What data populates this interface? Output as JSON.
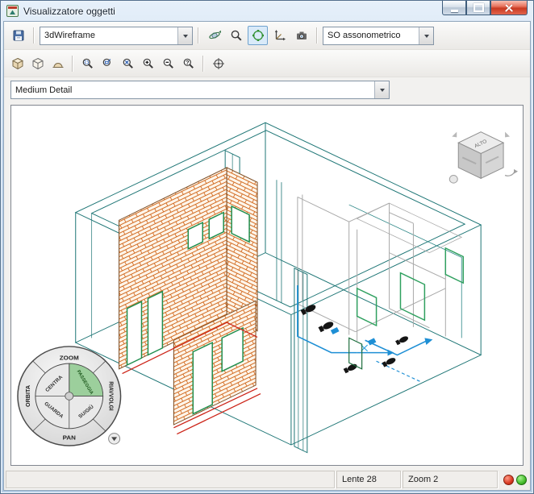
{
  "window": {
    "title": "Visualizzatore oggetti",
    "controls": [
      "minimize",
      "maximize",
      "close"
    ]
  },
  "toolbar_top": {
    "save_icon": "save-icon",
    "visual_style": {
      "value": "3dWireframe"
    },
    "buttons": [
      "orbit",
      "zoom",
      "constrained-orbit",
      "ucs-axes",
      "camera"
    ],
    "active_button": "constrained-orbit",
    "view_preset": {
      "value": "SO assonometrico"
    }
  },
  "toolbar_view": {
    "buttons": [
      "view-parallel",
      "view-perspective",
      "view-dome",
      "zoom-window",
      "zoom-dynamic",
      "zoom-extents",
      "zoom-in",
      "zoom-out",
      "zoom-help",
      "center-view"
    ]
  },
  "detail_combo": {
    "value": "Medium Detail"
  },
  "glyphs": {
    "question": "?"
  },
  "viewcube": {
    "top_label": "ALTO"
  },
  "wheel": {
    "zoom": "ZOOM",
    "riavvolgi": "RIAVVOLGI",
    "pan": "PAN",
    "orbita": "ORBITA",
    "centra": "CENTRA",
    "passeggia": "PASSEGGIA",
    "guarda": "GUARDA",
    "su_giu": "SU/GIÙ"
  },
  "status": {
    "lens": "Lente 28",
    "zoom": "Zoom 2"
  },
  "colors": {
    "wireframe_teal": "#1d7575",
    "brick_orange": "#d2691e",
    "frame_green": "#1e8e4e",
    "pipe_blue": "#1e8fd5",
    "floor_red": "#cc2418",
    "wheel_highlight": "#9ccf9c",
    "led_red": "#d93a22",
    "led_green": "#46bd2c"
  }
}
